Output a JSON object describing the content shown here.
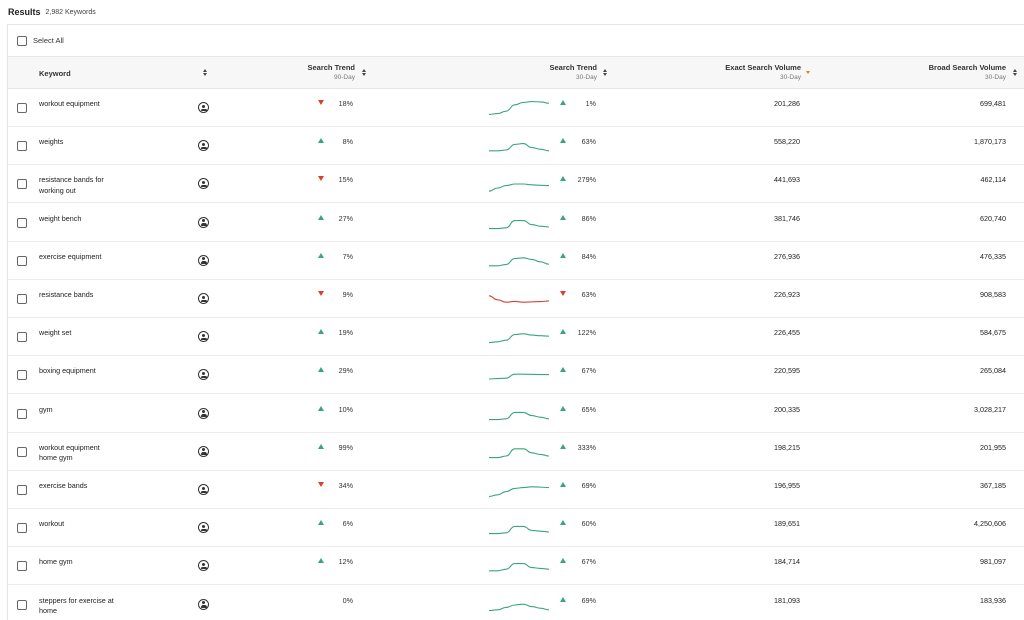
{
  "results": {
    "title": "Results",
    "count": "2,982 Keywords"
  },
  "select_all": {
    "label": "Select All"
  },
  "columns": {
    "keyword": "Keyword",
    "trend90": {
      "label": "Search Trend",
      "sub": "90-Day"
    },
    "trend30": {
      "label": "Search Trend",
      "sub": "30-Day"
    },
    "exact": {
      "label": "Exact Search Volume",
      "sub": "30-Day"
    },
    "broad": {
      "label": "Broad Search Volume",
      "sub": "30-Day"
    }
  },
  "colors": {
    "up": "#3aa57a",
    "down": "#d4432c",
    "sort_active": "#e07a2e"
  },
  "rows": [
    {
      "keyword": "workout equipment",
      "trend90_dir": "down",
      "trend90": "18%",
      "trend30_dir": "up",
      "trend30": "1%",
      "exact": "201,286",
      "broad": "699,481",
      "spark": [
        0.9,
        0.85,
        0.7,
        0.3,
        0.15,
        0.1,
        0.12,
        0.2
      ]
    },
    {
      "keyword": "weights",
      "trend90_dir": "up",
      "trend90": "8%",
      "trend30_dir": "up",
      "trend30": "63%",
      "exact": "558,220",
      "broad": "1,870,173",
      "spark": [
        0.8,
        0.8,
        0.75,
        0.4,
        0.35,
        0.6,
        0.7,
        0.8
      ]
    },
    {
      "keyword": "resistance bands for\nworking out",
      "trend90_dir": "down",
      "trend90": "15%",
      "trend30_dir": "up",
      "trend30": "279%",
      "exact": "441,693",
      "broad": "462,114",
      "spark": [
        0.95,
        0.75,
        0.6,
        0.5,
        0.5,
        0.55,
        0.58,
        0.6
      ]
    },
    {
      "keyword": "weight bench",
      "trend90_dir": "up",
      "trend90": "27%",
      "trend30_dir": "up",
      "trend30": "86%",
      "exact": "381,746",
      "broad": "620,740",
      "spark": [
        0.85,
        0.85,
        0.8,
        0.35,
        0.35,
        0.6,
        0.7,
        0.75
      ]
    },
    {
      "keyword": "exercise equipment",
      "trend90_dir": "up",
      "trend90": "7%",
      "trend30_dir": "up",
      "trend30": "84%",
      "exact": "276,936",
      "broad": "476,335",
      "spark": [
        0.8,
        0.8,
        0.72,
        0.35,
        0.3,
        0.4,
        0.55,
        0.7
      ]
    },
    {
      "keyword": "resistance bands",
      "trend90_dir": "down",
      "trend90": "9%",
      "trend30_dir": "down",
      "trend30": "63%",
      "exact": "226,923",
      "broad": "908,583",
      "spark": [
        0.3,
        0.55,
        0.7,
        0.65,
        0.7,
        0.68,
        0.66,
        0.62
      ]
    },
    {
      "keyword": "weight set",
      "trend90_dir": "up",
      "trend90": "19%",
      "trend30_dir": "up",
      "trend30": "122%",
      "exact": "226,455",
      "broad": "584,675",
      "spark": [
        0.85,
        0.8,
        0.7,
        0.35,
        0.3,
        0.38,
        0.42,
        0.45
      ]
    },
    {
      "keyword": "boxing equipment",
      "trend90_dir": "up",
      "trend90": "29%",
      "trend30_dir": "up",
      "trend30": "67%",
      "exact": "220,595",
      "broad": "265,084",
      "spark": [
        0.75,
        0.72,
        0.7,
        0.45,
        0.45,
        0.46,
        0.47,
        0.47
      ]
    },
    {
      "keyword": "gym",
      "trend90_dir": "up",
      "trend90": "10%",
      "trend30_dir": "up",
      "trend30": "65%",
      "exact": "200,335",
      "broad": "3,028,217",
      "spark": [
        0.85,
        0.85,
        0.8,
        0.4,
        0.4,
        0.6,
        0.7,
        0.8
      ]
    },
    {
      "keyword": "workout equipment\nhome gym",
      "trend90_dir": "up",
      "trend90": "99%",
      "trend30_dir": "up",
      "trend30": "333%",
      "exact": "198,215",
      "broad": "201,955",
      "spark": [
        0.85,
        0.85,
        0.75,
        0.3,
        0.3,
        0.55,
        0.65,
        0.75
      ]
    },
    {
      "keyword": "exercise bands",
      "trend90_dir": "down",
      "trend90": "34%",
      "trend30_dir": "up",
      "trend30": "69%",
      "exact": "196,955",
      "broad": "367,185",
      "spark": [
        0.9,
        0.8,
        0.6,
        0.4,
        0.35,
        0.3,
        0.32,
        0.35
      ]
    },
    {
      "keyword": "workout",
      "trend90_dir": "up",
      "trend90": "6%",
      "trend30_dir": "up",
      "trend30": "60%",
      "exact": "189,651",
      "broad": "4,250,606",
      "spark": [
        0.85,
        0.85,
        0.8,
        0.4,
        0.4,
        0.65,
        0.7,
        0.75
      ]
    },
    {
      "keyword": "home gym",
      "trend90_dir": "up",
      "trend90": "12%",
      "trend30_dir": "up",
      "trend30": "67%",
      "exact": "184,714",
      "broad": "981,097",
      "spark": [
        0.8,
        0.8,
        0.7,
        0.35,
        0.35,
        0.6,
        0.65,
        0.7
      ]
    },
    {
      "keyword": "steppers for exercise at\nhome",
      "trend90_dir": "none",
      "trend90": "0%",
      "trend30_dir": "up",
      "trend30": "69%",
      "exact": "181,093",
      "broad": "183,936",
      "spark": [
        0.85,
        0.8,
        0.65,
        0.5,
        0.45,
        0.6,
        0.7,
        0.8
      ]
    }
  ]
}
